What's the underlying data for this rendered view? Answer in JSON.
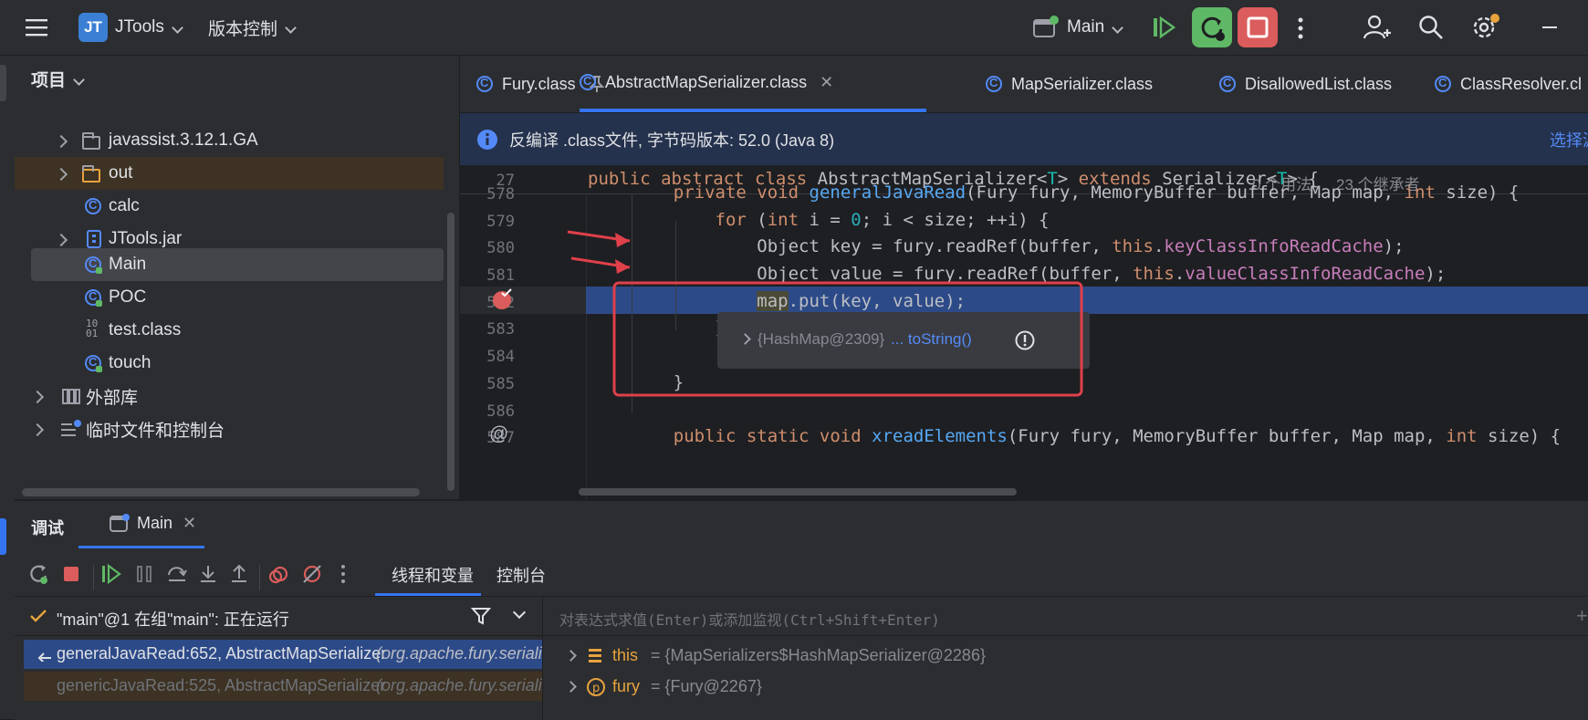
{
  "titlebar": {
    "project_badge": "JT",
    "project_name": "JTools",
    "vcs": "版本控制",
    "run_config": "Main"
  },
  "project_panel": {
    "title": "项目",
    "items": [
      {
        "label": "javassist.3.12.1.GA",
        "type": "folder"
      },
      {
        "label": "out",
        "type": "folder"
      },
      {
        "label": "calc",
        "type": "class"
      },
      {
        "label": "JTools.jar",
        "type": "jar"
      },
      {
        "label": "Main",
        "type": "run-class"
      },
      {
        "label": "POC",
        "type": "run-class"
      },
      {
        "label": "test.class",
        "type": "binary"
      },
      {
        "label": "touch",
        "type": "run-class"
      },
      {
        "label": "外部库",
        "type": "library"
      },
      {
        "label": "临时文件和控制台",
        "type": "scratch"
      }
    ]
  },
  "tabs": [
    {
      "label": "Fury.class"
    },
    {
      "label": "AbstractMapSerializer.class"
    },
    {
      "label": "MapSerializer.class"
    },
    {
      "label": "DisallowedList.class"
    },
    {
      "label": "ClassResolver.cl"
    }
  ],
  "banner": {
    "text": "反编译 .class文件, 字节码版本: 52.0 (Java 8)",
    "action": "选择源"
  },
  "editor": {
    "sticky": {
      "line": "27",
      "usages": "0 个用法",
      "inheritors": "23 个继承者"
    },
    "lines": [
      "578",
      "579",
      "580",
      "581",
      "582",
      "583",
      "584",
      "585",
      "586",
      "587"
    ],
    "popup": {
      "value": "{HashMap@2309}",
      "action": "... toString()"
    }
  },
  "debug": {
    "title": "调试",
    "session_tab": "Main",
    "subtabs": [
      "线程和变量",
      "控制台"
    ],
    "thread_status": "\"main\"@1 在组\"main\": 正在运行",
    "eval_placeholder": "对表达式求值(Enter)或添加监视(Ctrl+Shift+Enter)",
    "frames": [
      {
        "method": "generalJavaRead:652, AbstractMapSerializer",
        "pkg": "(org.apache.fury.serializ"
      },
      {
        "method": "genericJavaRead:525, AbstractMapSerializer",
        "pkg": "(org.apache.fury.serializ"
      }
    ],
    "variables": [
      {
        "name": "this",
        "value": "= {MapSerializers$HashMapSerializer@2286}"
      },
      {
        "name": "fury",
        "value": "= {Fury@2267}"
      }
    ]
  },
  "colors": {
    "accent": "#3574f0",
    "execution_line": "#2d4a88",
    "annotation_red": "#e0404a",
    "stop_button": "#db5c5c",
    "rerun_button": "#5fb865"
  }
}
